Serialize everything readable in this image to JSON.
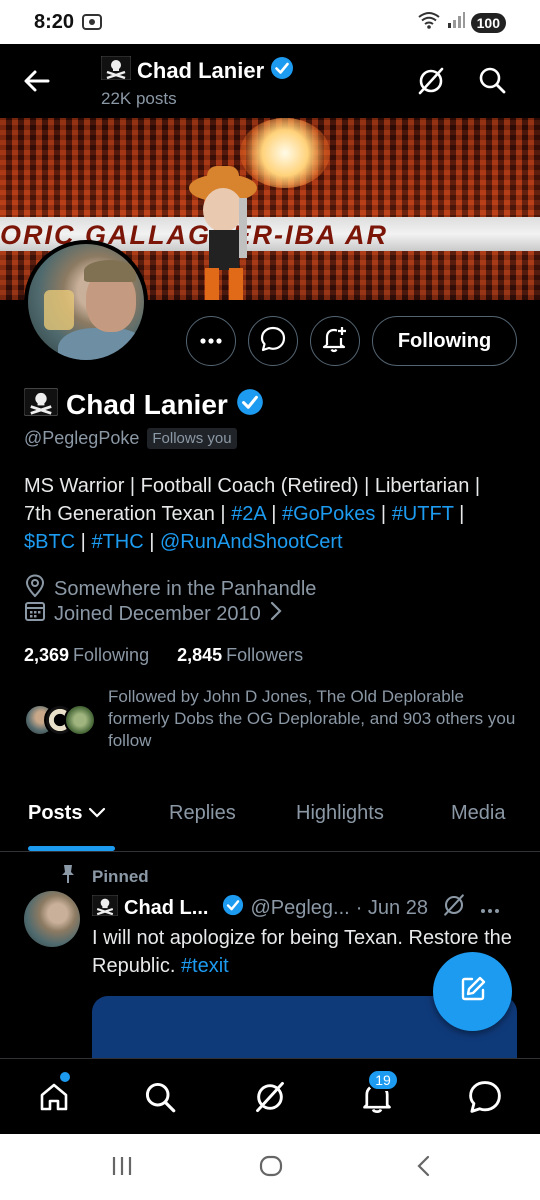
{
  "status_bar": {
    "time": "8:20",
    "battery": "100"
  },
  "top_bar": {
    "title": "Chad Lanier",
    "subtitle": "22K posts"
  },
  "banner": {
    "text": "ORIC GALLAGHER-IBA AR"
  },
  "actions": {
    "follow_label": "Following"
  },
  "profile": {
    "name": "Chad Lanier",
    "handle": "@PeglegPoke",
    "follows_you": "Follows you",
    "bio": {
      "line1": "MS Warrior | Football Coach (Retired) | Libertarian |",
      "line2_text": "7th Generation Texan | ",
      "tag_2a": "#2A",
      "sep1": " | ",
      "tag_gopokes": "#GoPokes",
      "sep2": " | ",
      "tag_utft": "#UTFT",
      "sep3": " |",
      "tag_btc": "$BTC",
      "sep4": " | ",
      "tag_thc": "#THC",
      "sep5": " | ",
      "mention": "@RunAndShootCert"
    },
    "location": "Somewhere in the Panhandle",
    "joined": "Joined December 2010",
    "following_count": "2,369",
    "following_label": "Following",
    "followers_count": "2,845",
    "followers_label": "Followers",
    "followed_by": "Followed by John D Jones, The Old Deplorable formerly Dobs the OG Deplorable, and 903 others you follow"
  },
  "tabs": [
    {
      "label": "Posts"
    },
    {
      "label": "Replies"
    },
    {
      "label": "Highlights"
    },
    {
      "label": "Media"
    }
  ],
  "pinned_tweet": {
    "pinned_label": "Pinned",
    "name": "Chad L...",
    "handle": "@Pegleg...",
    "date": "· Jun 28",
    "text": "I will not apologize for being Texan. Restore the Republic. ",
    "hashtag": "#texit"
  },
  "bottom_nav": {
    "notifications_badge": "19"
  },
  "colors": {
    "accent": "#1d9bf0",
    "background": "#000000",
    "muted": "#8b98a5"
  }
}
